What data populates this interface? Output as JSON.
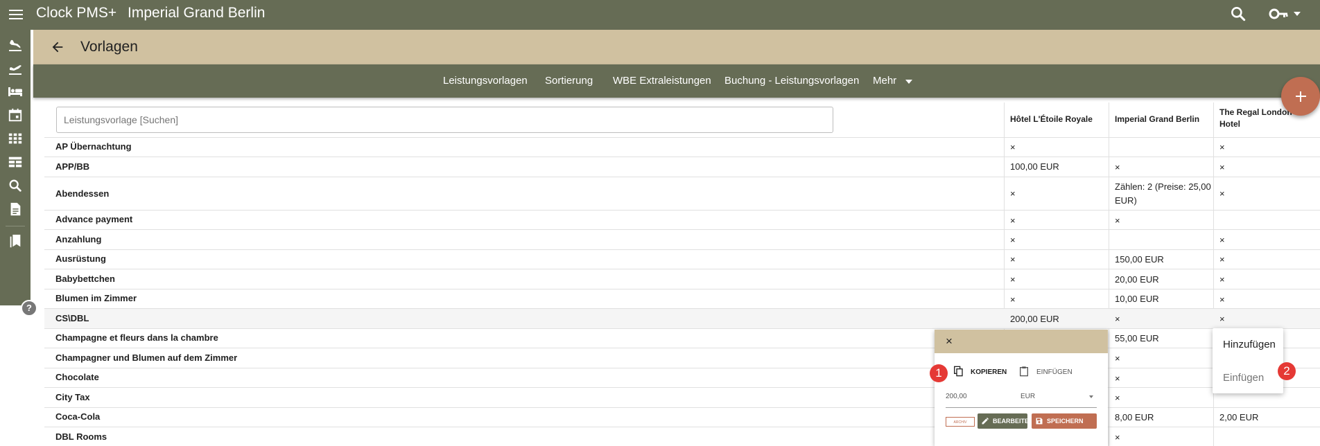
{
  "topbar": {
    "app_name": "Clock PMS+",
    "hotel_name": "Imperial Grand Berlin"
  },
  "page": {
    "title": "Vorlagen"
  },
  "tabs": [
    "Leistungsvorlagen",
    "Sortierung",
    "WBE Extraleistungen",
    "Buchung - Leistungsvorlagen",
    "Mehr"
  ],
  "search": {
    "placeholder": "Leistungsvorlage [Suchen]"
  },
  "columns": [
    "Hôtel L'Étoile Royale",
    "Imperial Grand Berlin",
    "The Regal London Hotel"
  ],
  "rows": [
    {
      "name": "AP Übernachtung",
      "c1": "×",
      "c2": "",
      "c3": "×"
    },
    {
      "name": "APP/BB",
      "c1": "100,00 EUR",
      "c2": "×",
      "c3": "×"
    },
    {
      "name": "Abendessen",
      "c1": "×",
      "c2": "Zählen: 2 (Preise: 25,00 EUR)",
      "c3": "×"
    },
    {
      "name": "Advance payment",
      "c1": "×",
      "c2": "×",
      "c3": ""
    },
    {
      "name": "Anzahlung",
      "c1": "×",
      "c2": "",
      "c3": "×"
    },
    {
      "name": "Ausrüstung",
      "c1": "×",
      "c2": "150,00 EUR",
      "c3": "×"
    },
    {
      "name": "Babybettchen",
      "c1": "×",
      "c2": "20,00 EUR",
      "c3": "×"
    },
    {
      "name": "Blumen im Zimmer",
      "c1": "×",
      "c2": "10,00 EUR",
      "c3": "×"
    },
    {
      "name": "CS\\DBL",
      "c1": "200,00 EUR",
      "c2": "×",
      "c3": "×"
    },
    {
      "name": "Champagne et fleurs dans la chambre",
      "c1": "",
      "c2": "55,00 EUR",
      "c3": ""
    },
    {
      "name": "Champagner und Blumen auf dem Zimmer",
      "c1": "",
      "c2": "×",
      "c3": ""
    },
    {
      "name": "Chocolate",
      "c1": "",
      "c2": "×",
      "c3": ""
    },
    {
      "name": "City Tax",
      "c1": "",
      "c2": "×",
      "c3": ""
    },
    {
      "name": "Coca-Cola",
      "c1": "",
      "c2": "8,00 EUR",
      "c3": "2,00 EUR"
    },
    {
      "name": "DBL Rooms",
      "c1": "",
      "c2": "×",
      "c3": ""
    }
  ],
  "popup": {
    "close": "×",
    "copy_label": "KOPIEREN",
    "paste_label": "EINFÜGEN",
    "price_value": "200,00",
    "currency": "EUR",
    "archive_label": "ARCHIV",
    "edit_label": "BEARBEITEN",
    "save_label": "SPEICHERN"
  },
  "context_menu": {
    "add": "Hinzufügen",
    "paste": "Einfügen"
  },
  "badges": [
    "1",
    "2"
  ],
  "help": "?",
  "colors": {
    "olive": "#666c55",
    "tan": "#d0c1a0",
    "accent": "#c06e52",
    "badge": "#e53935"
  }
}
